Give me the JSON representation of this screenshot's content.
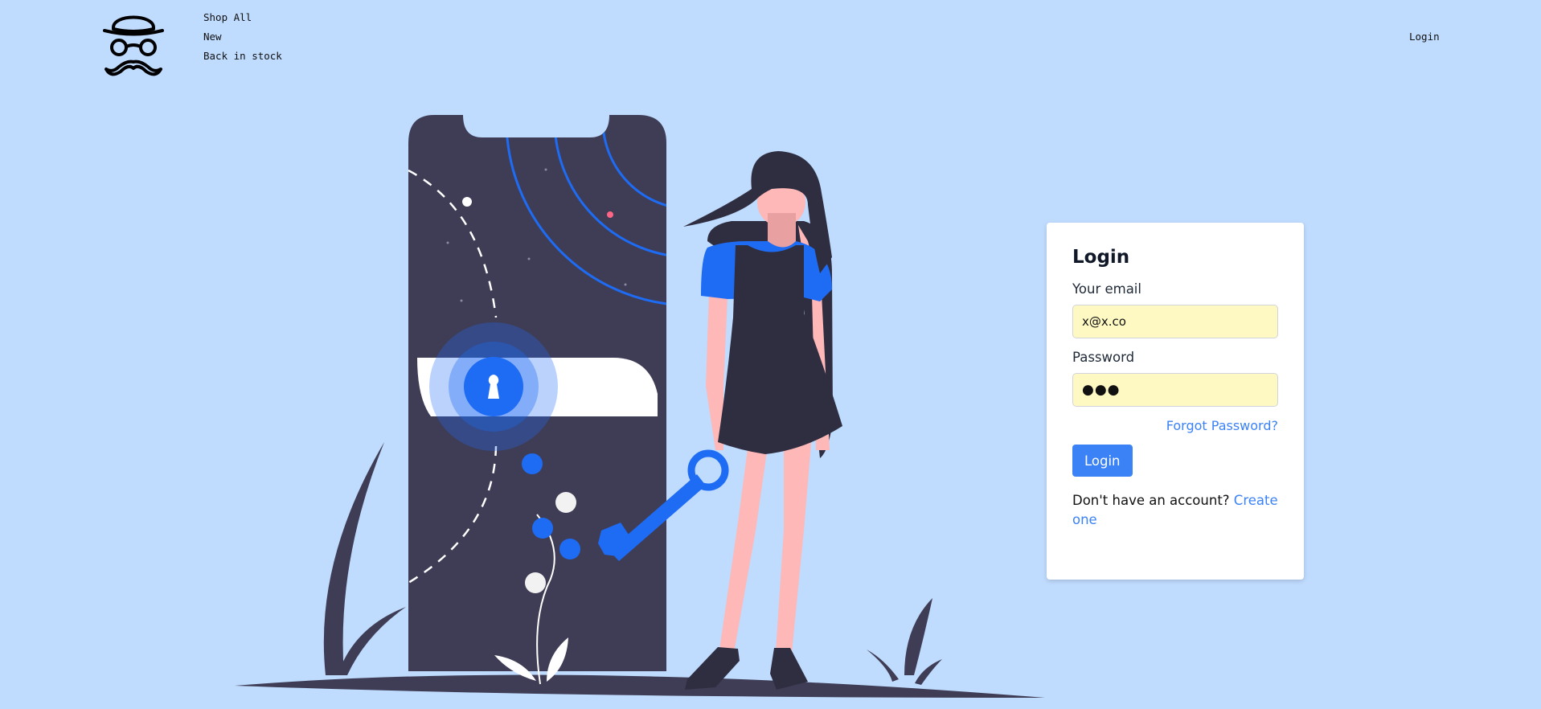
{
  "nav": {
    "items": [
      "Shop All",
      "New",
      "Back in stock"
    ],
    "login": "Login"
  },
  "illustration": {
    "icons": [
      "padlock-keyhole-icon",
      "key-icon"
    ]
  },
  "login_form": {
    "title": "Login",
    "email_label": "Your email",
    "email_value": "x@x.co",
    "password_label": "Password",
    "password_display": "●●●",
    "forgot_password": "Forgot Password?",
    "submit_label": "Login",
    "signup_prompt": "Don't have an account?",
    "signup_link": "Create one"
  },
  "colors": {
    "background": "#bfdbfe",
    "accent": "#3b82f6",
    "illustration_dark": "#3f3d56",
    "illustration_blue": "#1e6bf4",
    "input_autofill": "#fef9c3"
  }
}
